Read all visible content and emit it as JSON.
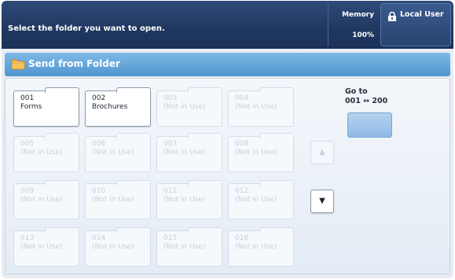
{
  "header": {
    "message": "Select the folder you want to open.",
    "memory_label": "Memory",
    "memory_value": "100%",
    "user_label": "Local User"
  },
  "titlebar": {
    "title": "Send from Folder"
  },
  "folders": [
    {
      "number": "001",
      "name": "Forms"
    },
    {
      "number": "002",
      "name": "Brochures"
    },
    {
      "number": "003",
      "name": "(Not in Use)"
    },
    {
      "number": "004",
      "name": "(Not in Use)"
    },
    {
      "number": "005",
      "name": "(Not in Use)"
    },
    {
      "number": "006",
      "name": "(Not in Use)"
    },
    {
      "number": "007",
      "name": "(Not in Use)"
    },
    {
      "number": "008",
      "name": "(Not in Use)"
    },
    {
      "number": "009",
      "name": "(Not in Use)"
    },
    {
      "number": "010",
      "name": "(Not in Use)"
    },
    {
      "number": "011",
      "name": "(Not in Use)"
    },
    {
      "number": "012",
      "name": "(Not in Use)"
    },
    {
      "number": "013",
      "name": "(Not in Use)"
    },
    {
      "number": "014",
      "name": "(Not in Use)"
    },
    {
      "number": "015",
      "name": "(Not in Use)"
    },
    {
      "number": "016",
      "name": "(Not in Use)"
    }
  ],
  "goto": {
    "label_line1": "Go to",
    "label_line2": "001 ↔ 200"
  },
  "scroll": {
    "up_glyph": "▲",
    "down_glyph": "▼"
  },
  "icons": {
    "user": "user-lock-icon",
    "folder": "folder-icon"
  },
  "colors": {
    "header_bg": "#203860",
    "title_bg": "#4f95cf",
    "goto_button": "#8fbae6"
  }
}
